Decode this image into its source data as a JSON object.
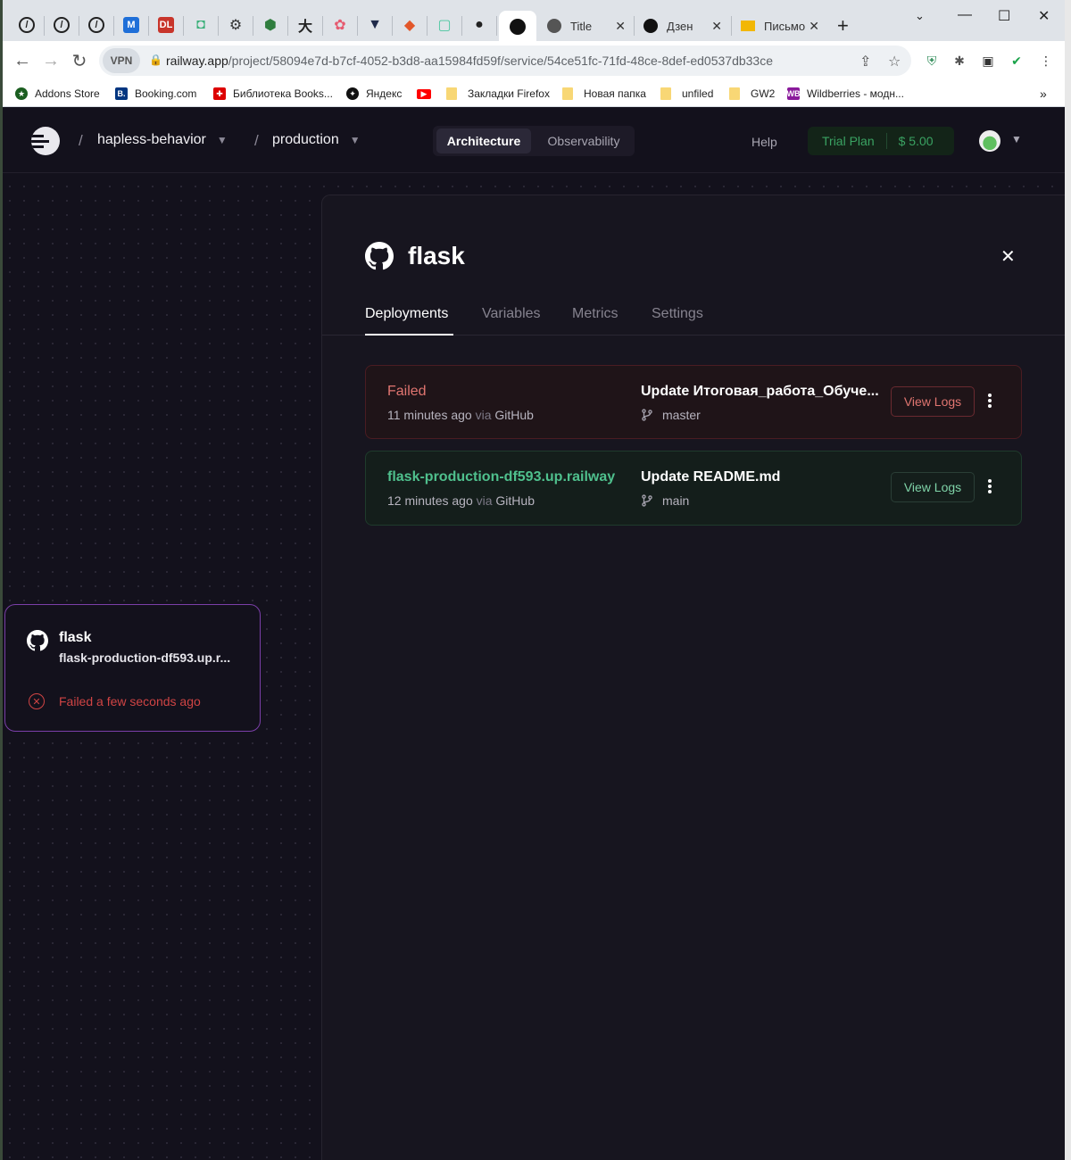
{
  "browser": {
    "tabs": [
      {
        "icon": "gitbook-icon",
        "color": "#222222"
      },
      {
        "icon": "gitbook-icon",
        "color": "#222222"
      },
      {
        "icon": "gitbook-icon",
        "color": "#222222"
      },
      {
        "icon": "m-icon",
        "color": "#1f6fd8",
        "glyph": "M"
      },
      {
        "icon": "dl-icon",
        "color": "#c8352b",
        "glyph": "DL"
      },
      {
        "icon": "robot-icon",
        "color": "#3bb07a",
        "glyph": "◘"
      },
      {
        "icon": "tools-icon",
        "color": "#333333",
        "glyph": "⚙"
      },
      {
        "icon": "shield-icon",
        "color": "#2f7d3e",
        "glyph": "⬢"
      },
      {
        "icon": "kanji-icon",
        "color": "#222222",
        "glyph": "大"
      },
      {
        "icon": "flower-icon",
        "color": "#e65a6f",
        "glyph": "✿"
      },
      {
        "icon": "badge-icon",
        "color": "#1f2a4a",
        "glyph": "▼"
      },
      {
        "icon": "gitlab-icon",
        "color": "#e2572a",
        "glyph": "◆"
      },
      {
        "icon": "square-icon",
        "color": "#4cc7a0",
        "glyph": "▢"
      },
      {
        "icon": "github-icon",
        "color": "#222222",
        "glyph": "●"
      }
    ],
    "named_tabs": [
      {
        "title": "Title"
      },
      {
        "title": "Дзен"
      },
      {
        "title": "Письмо"
      }
    ],
    "vpn_label": "VPN",
    "url_host": "railway.app",
    "url_path": "/project/58094e7d-b7cf-4052-b3d8-aa15984fd59f/service/54ce51fc-71fd-48ce-8def-ed0537db33ce",
    "bookmarks": [
      "Addons Store",
      "Booking.com",
      "Библиотека Books...",
      "Яндекс",
      "",
      "Закладки Firefox",
      "Новая папка",
      "unfiled",
      "GW2",
      "Wildberries - модн..."
    ],
    "more_bookmarks": "»"
  },
  "app": {
    "project_name": "hapless-behavior",
    "environment": "production",
    "nav": {
      "architecture": "Architecture",
      "observability": "Observability",
      "help": "Help",
      "trial_plan": "Trial Plan",
      "credit": "$ 5.00"
    },
    "node": {
      "title": "flask",
      "url": "flask-production-df593.up.r...",
      "status": "Failed a few seconds ago"
    },
    "panel": {
      "title": "flask",
      "tabs": [
        "Deployments",
        "Variables",
        "Metrics",
        "Settings"
      ],
      "deployments": [
        {
          "status": "Failed",
          "time": "11 minutes ago",
          "via": "via",
          "source": "GitHub",
          "commit": "Update Итоговая_работа_Обуче...",
          "branch": "master",
          "action": "View Logs"
        },
        {
          "status": "flask-production-df593.up.railway",
          "time": "12 minutes ago",
          "via": "via",
          "source": "GitHub",
          "commit": "Update README.md",
          "branch": "main",
          "action": "View Logs"
        }
      ]
    }
  },
  "colors": {
    "failed": "#e07570",
    "success": "#4fc08d",
    "accent_purple": "#7b3fa8",
    "background": "#13111c"
  }
}
